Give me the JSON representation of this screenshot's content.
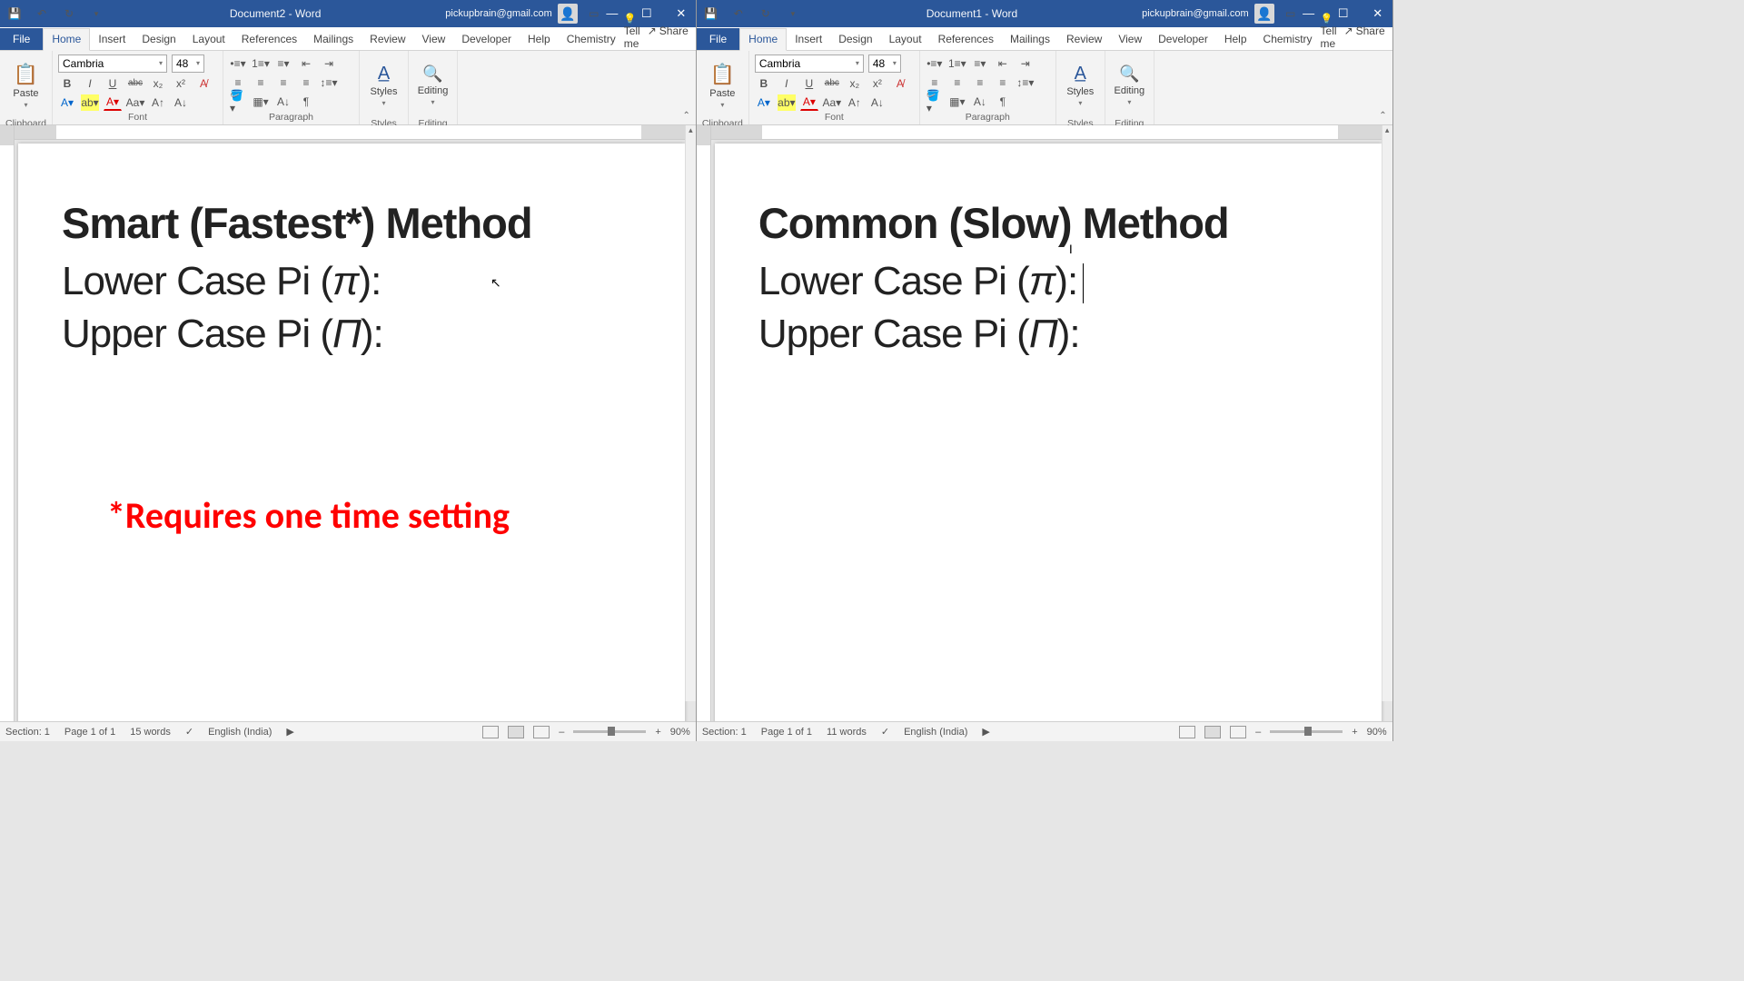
{
  "left": {
    "doc_title": "Document2  -  Word",
    "email": "pickupbrain@gmail.com",
    "tabs": [
      "File",
      "Home",
      "Insert",
      "Design",
      "Layout",
      "References",
      "Mailings",
      "Review",
      "View",
      "Developer",
      "Help",
      "Chemistry"
    ],
    "tellme": "Tell me",
    "share": "Share",
    "font_name": "Cambria",
    "font_size": "48",
    "groups": {
      "clipboard": "Clipboard",
      "font": "Font",
      "paragraph": "Paragraph",
      "styles": "Styles",
      "editing": "Editing"
    },
    "paste": "Paste",
    "styles": "Styles",
    "editing": "Editing",
    "content": {
      "heading": "Smart (Fastest*) Method",
      "line1_a": "Lower Case Pi (",
      "line1_sym": "π",
      "line1_b": "):",
      "line2_a": "Upper Case Pi (",
      "line2_sym": "Π",
      "line2_b": "):",
      "footnote": "*Requires one time setting"
    },
    "status": {
      "section": "Section: 1",
      "page": "Page 1 of 1",
      "words": "15 words",
      "lang": "English (India)",
      "zoom": "90%"
    }
  },
  "right": {
    "doc_title": "Document1  -  Word",
    "email": "pickupbrain@gmail.com",
    "tabs": [
      "File",
      "Home",
      "Insert",
      "Design",
      "Layout",
      "References",
      "Mailings",
      "Review",
      "View",
      "Developer",
      "Help",
      "Chemistry"
    ],
    "tellme": "Tell me",
    "share": "Share",
    "font_name": "Cambria",
    "font_size": "48",
    "groups": {
      "clipboard": "Clipboard",
      "font": "Font",
      "paragraph": "Paragraph",
      "styles": "Styles",
      "editing": "Editing"
    },
    "paste": "Paste",
    "styles": "Styles",
    "editing": "Editing",
    "content": {
      "heading": "Common (Slow) Method",
      "line1_a": "Lower Case Pi (",
      "line1_sym": "π",
      "line1_b": "):",
      "line2_a": "Upper Case Pi (",
      "line2_sym": "Π",
      "line2_b": "):"
    },
    "status": {
      "section": "Section: 1",
      "page": "Page 1 of 1",
      "words": "11 words",
      "lang": "English (India)",
      "zoom": "90%"
    }
  }
}
